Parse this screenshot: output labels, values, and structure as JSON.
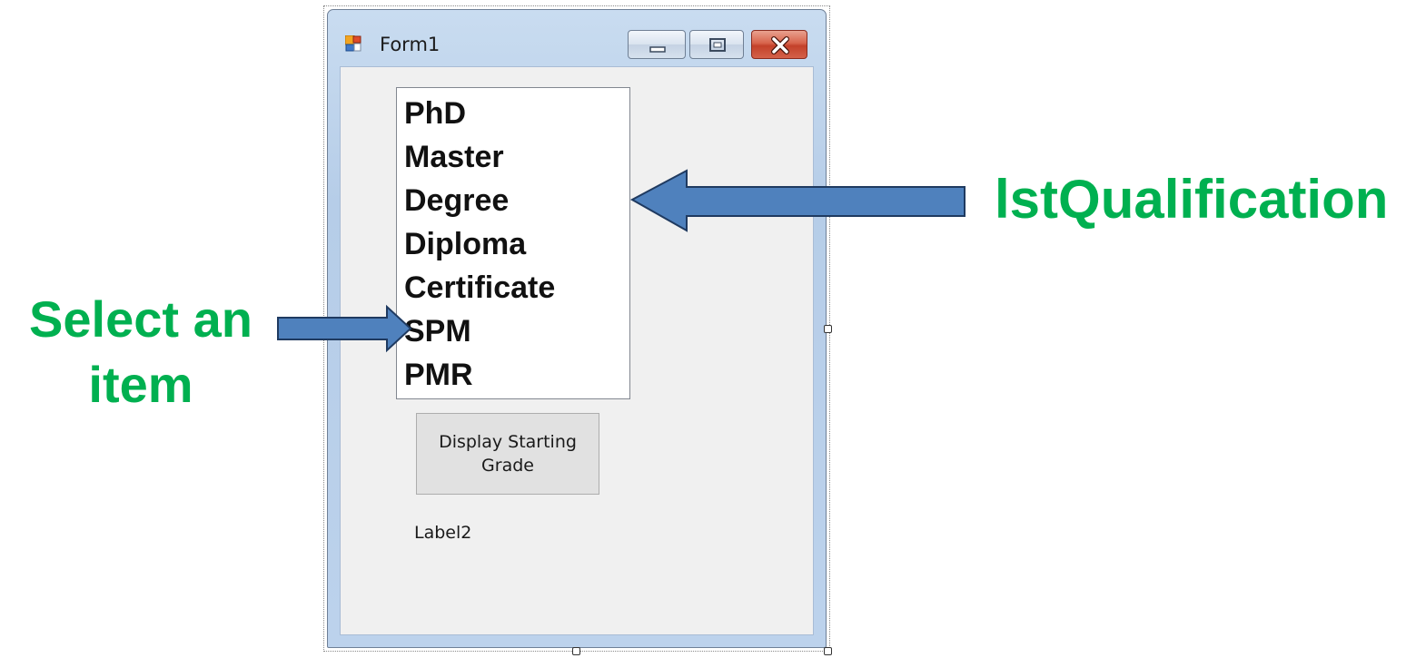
{
  "window": {
    "title": "Form1"
  },
  "listbox": {
    "items": [
      "PhD",
      "Master",
      "Degree",
      "Diploma",
      "Certificate",
      "SPM",
      "PMR"
    ]
  },
  "button": {
    "label": "Display Starting Grade"
  },
  "label": {
    "text": "Label2"
  },
  "annotations": {
    "listbox_name": "lstQualification",
    "select_line1": "Select an",
    "select_line2": "item"
  },
  "colors": {
    "annotation_text": "#00b050",
    "arrow_fill": "#4f81bd",
    "arrow_stroke": "#1f3a60",
    "close_button": "#c3412a"
  },
  "icons": {
    "app": "form-app-icon",
    "minimize": "minimize-icon",
    "maximize": "maximize-icon",
    "close": "close-icon"
  }
}
